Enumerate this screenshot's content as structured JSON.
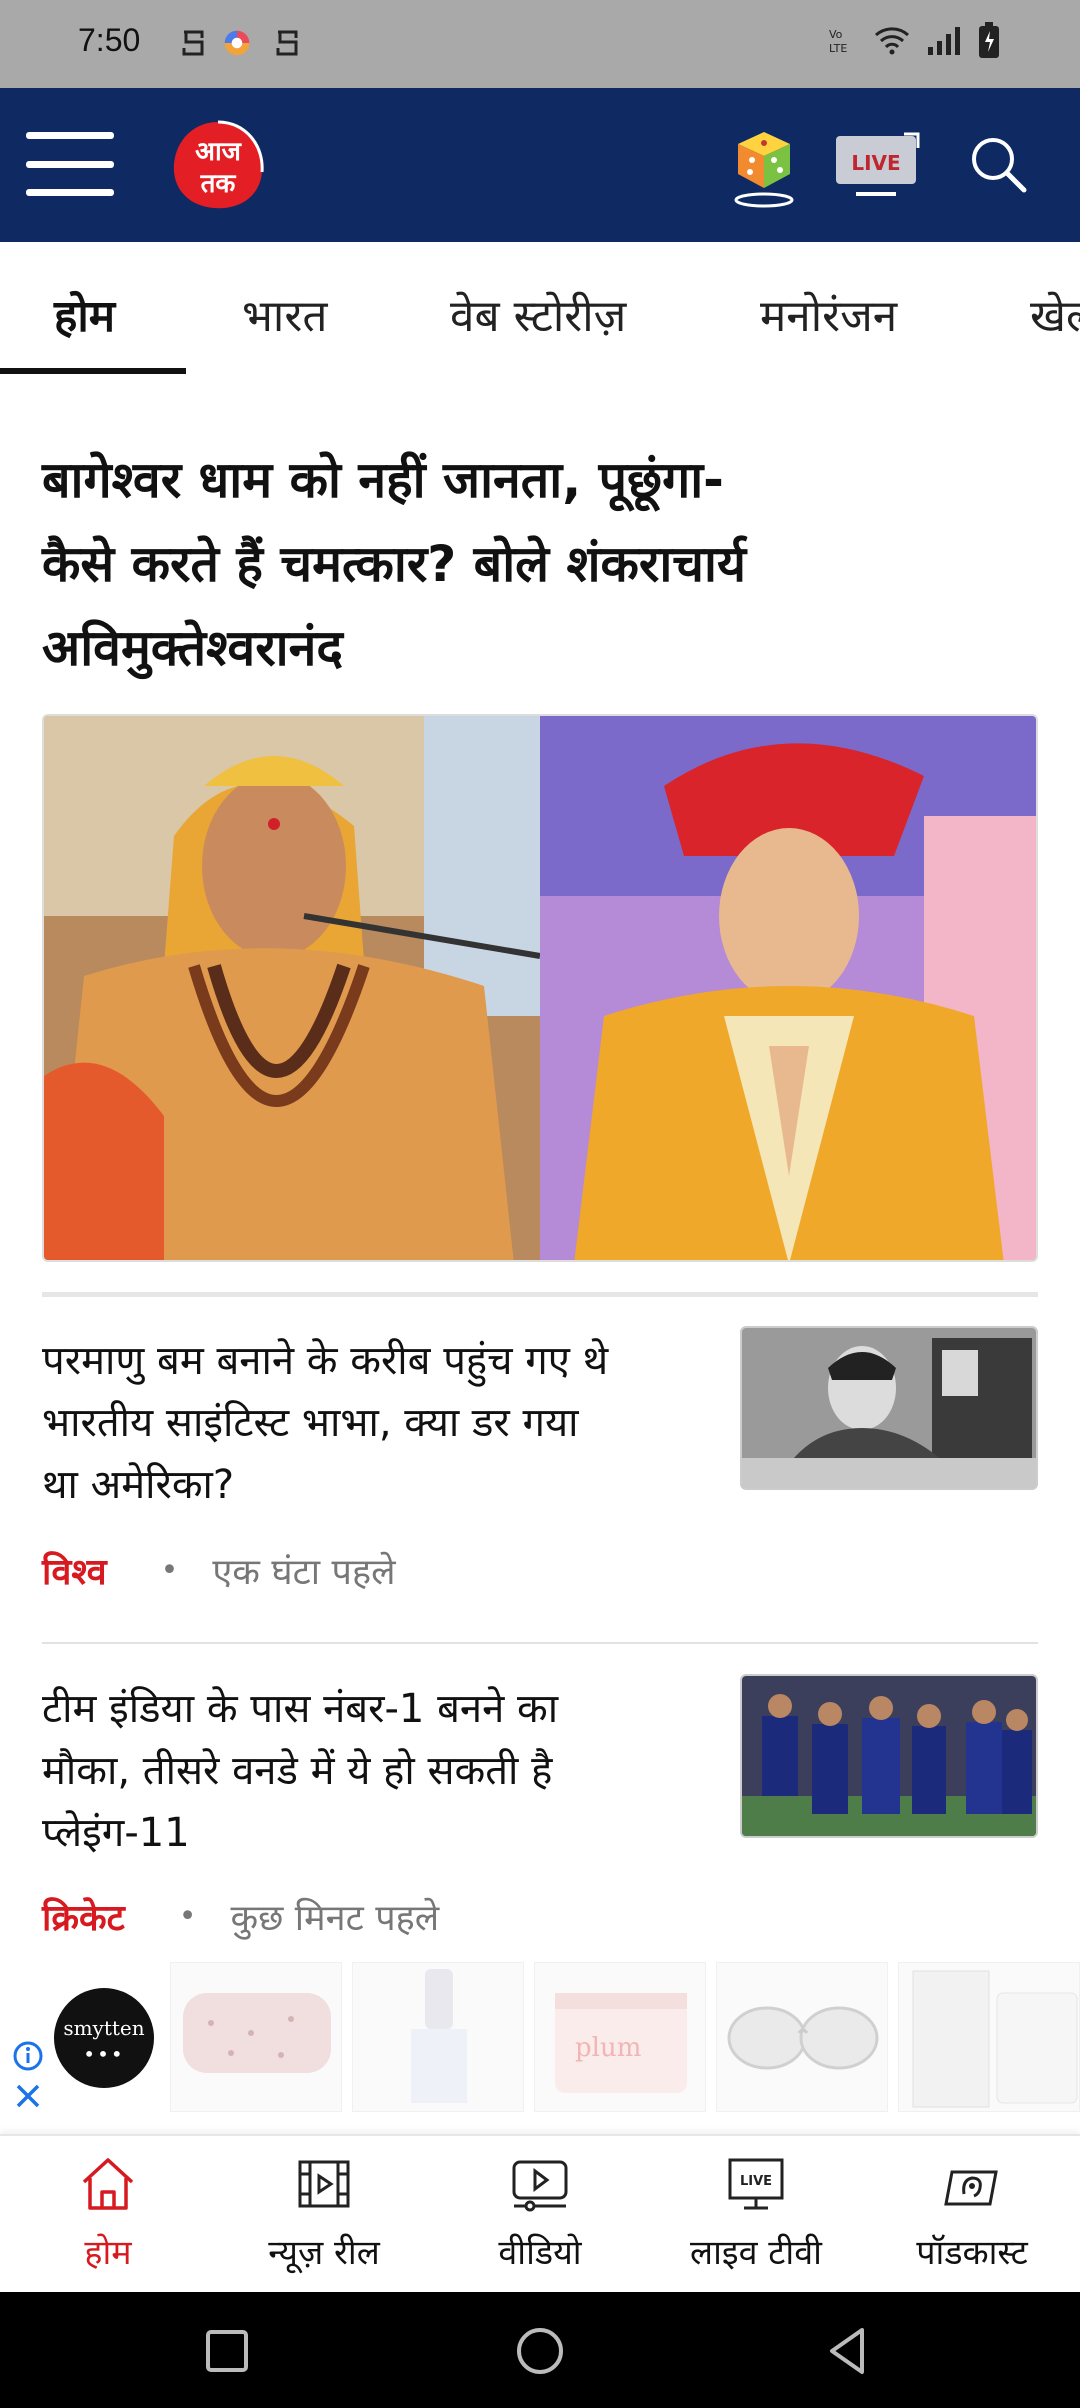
{
  "status_bar": {
    "time": "7:50"
  },
  "header": {
    "logo_text": "आज तक",
    "live_label": "LIVE",
    "brand_color": "#0f2a63"
  },
  "tabs": [
    {
      "label": "होम",
      "active": true
    },
    {
      "label": "भारत",
      "active": false
    },
    {
      "label": "वेब स्टोरीज़",
      "active": false
    },
    {
      "label": "मनोरंजन",
      "active": false
    },
    {
      "label": "खेल",
      "active": false
    }
  ],
  "top_story": {
    "headline_lines": [
      "बागेश्वर धाम को नहीं जानता, पूछूंगा-",
      "कैसे करते हैं चमत्कार? बोले शंकराचार्य",
      "अविमुक्तेश्वरानंद"
    ]
  },
  "stories": [
    {
      "title_lines": [
        "परमाणु बम बनाने के करीब पहुंच गए थे",
        "भारतीय साइंटिस्ट भाभा, क्या डर गया",
        "था अमेरिका?"
      ],
      "category": "विश्व",
      "time": "एक घंटा पहले"
    },
    {
      "title_lines": [
        "टीम इंडिया के पास नंबर-1 बनने का",
        "मौका, तीसरे वनडे में ये हो सकती है",
        "प्लेइंग-11"
      ],
      "category": "क्रिकेट",
      "time": "कुछ मिनट पहले"
    }
  ],
  "ad": {
    "brand": "smytten",
    "product_text": "plum"
  },
  "bottom_nav": [
    {
      "label": "होम",
      "icon": "home-icon",
      "active": true
    },
    {
      "label": "न्यूज़ रील",
      "icon": "film-reel-icon",
      "active": false
    },
    {
      "label": "वीडियो",
      "icon": "video-play-icon",
      "active": false
    },
    {
      "label": "लाइव टीवी",
      "icon": "live-tv-icon",
      "active": false
    },
    {
      "label": "पॉडकास्ट",
      "icon": "podcast-icon",
      "active": false
    }
  ],
  "colors": {
    "accent_red": "#d71920",
    "meta_gray": "#777777"
  }
}
